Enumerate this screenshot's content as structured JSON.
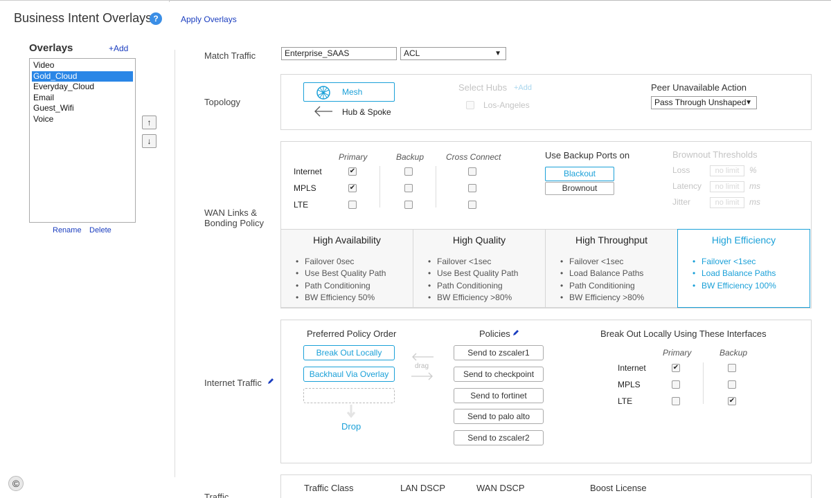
{
  "header": {
    "title": "Business Intent Overlays",
    "help_icon": "?",
    "apply_label": "Apply Overlays"
  },
  "overlays": {
    "title": "Overlays",
    "add_label": "+Add",
    "items": [
      "Video",
      "Gold_Cloud",
      "Everyday_Cloud",
      "Email",
      "Guest_Wifi",
      "Voice"
    ],
    "selected": "Gold_Cloud",
    "move_up": "↑",
    "move_down": "↓",
    "rename_label": "Rename",
    "delete_label": "Delete"
  },
  "match_traffic": {
    "label": "Match Traffic",
    "value": "Enterprise_SAAS",
    "acl_value": "ACL"
  },
  "topology": {
    "label": "Topology",
    "mesh_label": "Mesh",
    "hub_spoke_label": "Hub & Spoke",
    "select_hubs_label": "Select Hubs",
    "add_label": "+Add",
    "hub_option": "Los-Angeles",
    "peer_action_label": "Peer Unavailable Action",
    "peer_action_value": "Pass Through Unshaped"
  },
  "wan": {
    "label_line1": "WAN Links &",
    "label_line2": "Bonding Policy",
    "col_primary": "Primary",
    "col_backup": "Backup",
    "col_cross": "Cross Connect",
    "rows": [
      {
        "name": "Internet",
        "primary": "✔",
        "backup": "",
        "cross": ""
      },
      {
        "name": "MPLS",
        "primary": "✔",
        "backup": "",
        "cross": ""
      },
      {
        "name": "LTE",
        "primary": "",
        "backup": "",
        "cross": ""
      }
    ],
    "backup_ports_label": "Use Backup Ports on",
    "blackout_label": "Blackout",
    "brownout_label": "Brownout",
    "thresholds_label": "Brownout Thresholds",
    "loss_label": "Loss",
    "loss_value": "no limit",
    "loss_unit": "%",
    "latency_label": "Latency",
    "latency_value": "no limit",
    "latency_unit": "ms",
    "jitter_label": "Jitter",
    "jitter_value": "no limit",
    "jitter_unit": "ms"
  },
  "modes": [
    {
      "title": "High Availability",
      "items": [
        "Failover 0sec",
        "Use Best Quality Path",
        "Path Conditioning",
        "BW Efficiency 50%"
      ]
    },
    {
      "title": "High Quality",
      "items": [
        "Failover <1sec",
        "Use Best Quality Path",
        "Path Conditioning",
        "BW Efficiency >80%"
      ]
    },
    {
      "title": "High Throughput",
      "items": [
        "Failover <1sec",
        "Load Balance Paths",
        "Path Conditioning",
        "BW Efficiency >80%"
      ]
    },
    {
      "title": "High Efficiency",
      "items": [
        "Failover <1sec",
        "Load Balance Paths",
        "BW Efficiency 100%"
      ]
    }
  ],
  "internet": {
    "label": "Internet Traffic",
    "order_title": "Preferred Policy Order",
    "order_items": [
      "Break Out Locally",
      "Backhaul Via Overlay"
    ],
    "drag_label": "drag",
    "drop_label": "Drop",
    "policies_title": "Policies",
    "policies": [
      "Send to zscaler1",
      "Send to checkpoint",
      "Send to fortinet",
      "Send to palo alto",
      "Send to zscaler2"
    ],
    "breakout_title": "Break Out Locally Using These Interfaces",
    "col_primary": "Primary",
    "col_backup": "Backup",
    "rows": [
      {
        "name": "Internet",
        "primary": "✔",
        "backup": ""
      },
      {
        "name": "MPLS",
        "primary": "",
        "backup": ""
      },
      {
        "name": "LTE",
        "primary": "",
        "backup": "✔"
      }
    ]
  },
  "traffic_section": {
    "label": "Traffic",
    "class_label": "Traffic Class",
    "lan_dscp_label": "LAN DSCP",
    "wan_dscp_label": "WAN DSCP",
    "boost_label": "Boost License"
  },
  "footer": {
    "copyright_icon": "©"
  },
  "colors": {
    "accent": "#1aa0d8",
    "selection": "#2a86e6",
    "link": "#1a3dbf"
  }
}
